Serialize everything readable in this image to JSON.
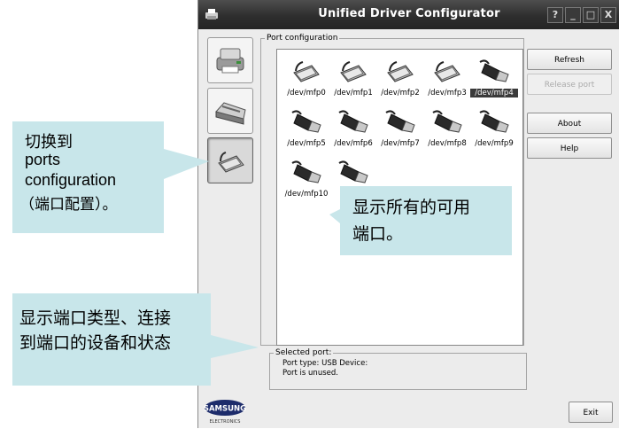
{
  "window": {
    "title": "Unified Driver Configurator",
    "controls": {
      "help": "?",
      "minimize": "_",
      "maximize": "□",
      "close": "X"
    }
  },
  "port_config": {
    "legend": "Port configuration",
    "ports": [
      {
        "label": "/dev/mfp0",
        "type": "parallel"
      },
      {
        "label": "/dev/mfp1",
        "type": "parallel"
      },
      {
        "label": "/dev/mfp2",
        "type": "parallel"
      },
      {
        "label": "/dev/mfp3",
        "type": "parallel"
      },
      {
        "label": "/dev/mfp4",
        "type": "usb",
        "selected": true
      },
      {
        "label": "/dev/mfp5",
        "type": "usb"
      },
      {
        "label": "/dev/mfp6",
        "type": "usb"
      },
      {
        "label": "/dev/mfp7",
        "type": "usb"
      },
      {
        "label": "/dev/mfp8",
        "type": "usb"
      },
      {
        "label": "/dev/mfp9",
        "type": "usb"
      },
      {
        "label": "/dev/mfp10",
        "type": "usb"
      },
      {
        "label": "/de",
        "type": "usb"
      }
    ]
  },
  "buttons": {
    "refresh": "Refresh",
    "release_port": "Release port",
    "about": "About",
    "help": "Help",
    "exit": "Exit"
  },
  "selected_port": {
    "legend": "Selected port:",
    "line1": "Port type: USB   Device:",
    "line2": "Port is unused."
  },
  "logo": {
    "brand": "SAMSUNG",
    "sub": "ELECTRONICS"
  },
  "annotations": {
    "switch_lines": [
      "切换到",
      "ports",
      "configuration",
      "（端口配置）。"
    ],
    "show_ports_lines": [
      "显示所有的可用",
      "端口。"
    ],
    "show_type_lines": [
      "显示端口类型、连接",
      "到端口的设备和状态"
    ]
  },
  "colors": {
    "callout": "#c8e6ea",
    "titlebar": "#2e2e2e",
    "window": "#ececec"
  }
}
